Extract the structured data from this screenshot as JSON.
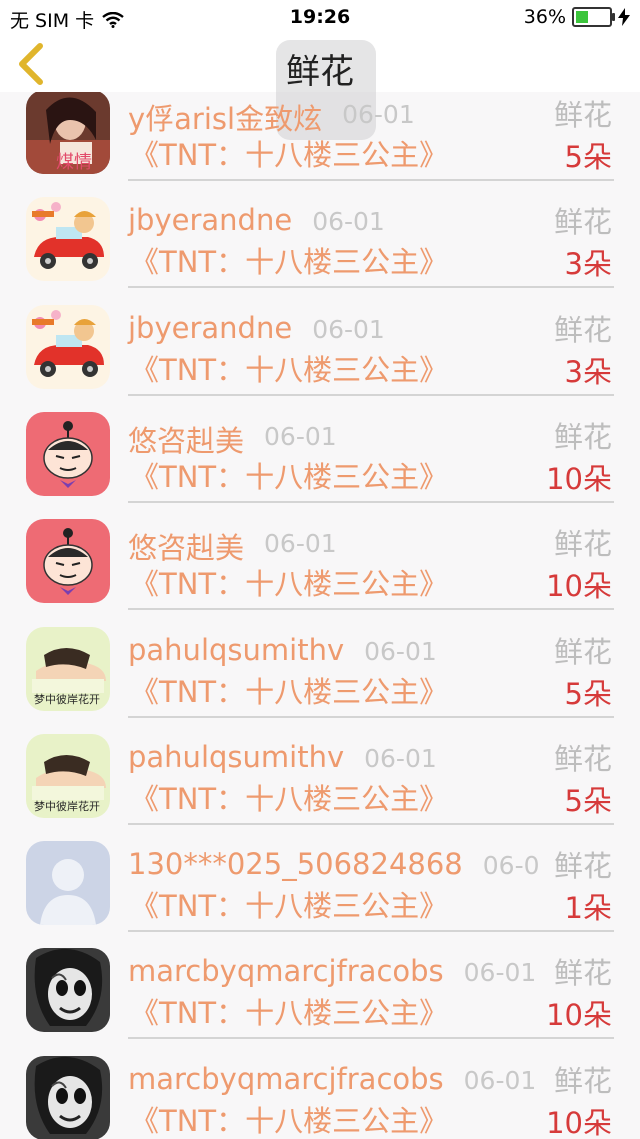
{
  "status_bar": {
    "carrier": "无 SIM 卡",
    "time": "19:26",
    "battery_percent": "36%",
    "battery_level": 0.36
  },
  "nav": {
    "title": "鲜花"
  },
  "rows": [
    {
      "name": "y俘arisl金致炫",
      "date": "06-01",
      "label": "鲜花",
      "book": "《TNT：十八楼三公主》",
      "count": "5朵",
      "avatar": "photo-woman-avatar"
    },
    {
      "name": "jbyerandne",
      "date": "06-01",
      "label": "鲜花",
      "book": "《TNT：十八楼三公主》",
      "count": "3朵",
      "avatar": "cartoon-car-avatar"
    },
    {
      "name": "jbyerandne",
      "date": "06-01",
      "label": "鲜花",
      "book": "《TNT：十八楼三公主》",
      "count": "3朵",
      "avatar": "cartoon-car-avatar"
    },
    {
      "name": "悠咨赳美",
      "date": "06-01",
      "label": "鲜花",
      "book": "《TNT：十八楼三公主》",
      "count": "10朵",
      "avatar": "cartoon-girl-avatar"
    },
    {
      "name": "悠咨赳美",
      "date": "06-01",
      "label": "鲜花",
      "book": "《TNT：十八楼三公主》",
      "count": "10朵",
      "avatar": "cartoon-girl-avatar"
    },
    {
      "name": "pahulqsumithv",
      "date": "06-01",
      "label": "鲜花",
      "book": "《TNT：十八楼三公主》",
      "count": "5朵",
      "avatar": "sleeping-person-avatar",
      "avatar_caption": "梦中彼岸花开"
    },
    {
      "name": "pahulqsumithv",
      "date": "06-01",
      "label": "鲜花",
      "book": "《TNT：十八楼三公主》",
      "count": "5朵",
      "avatar": "sleeping-person-avatar",
      "avatar_caption": "梦中彼岸花开"
    },
    {
      "name": "130***025_506824868",
      "date": "06-0",
      "label": "鲜花",
      "book": "《TNT：十八楼三公主》",
      "count": "1朵",
      "avatar": "default-person-avatar"
    },
    {
      "name": "marcbyqmarcjfracobs",
      "date": "06-01",
      "label": "鲜花",
      "book": "《TNT：十八楼三公主》",
      "count": "10朵",
      "avatar": "mask-face-avatar"
    },
    {
      "name": "marcbyqmarcjfracobs",
      "date": "06-01",
      "label": "鲜花",
      "book": "《TNT：十八楼三公主》",
      "count": "10朵",
      "avatar": "mask-face-avatar"
    }
  ],
  "colors": {
    "name": "#ee9a6e",
    "count": "#d63a3a",
    "label": "#bdbdbd",
    "back_arrow": "#e0b52c"
  }
}
